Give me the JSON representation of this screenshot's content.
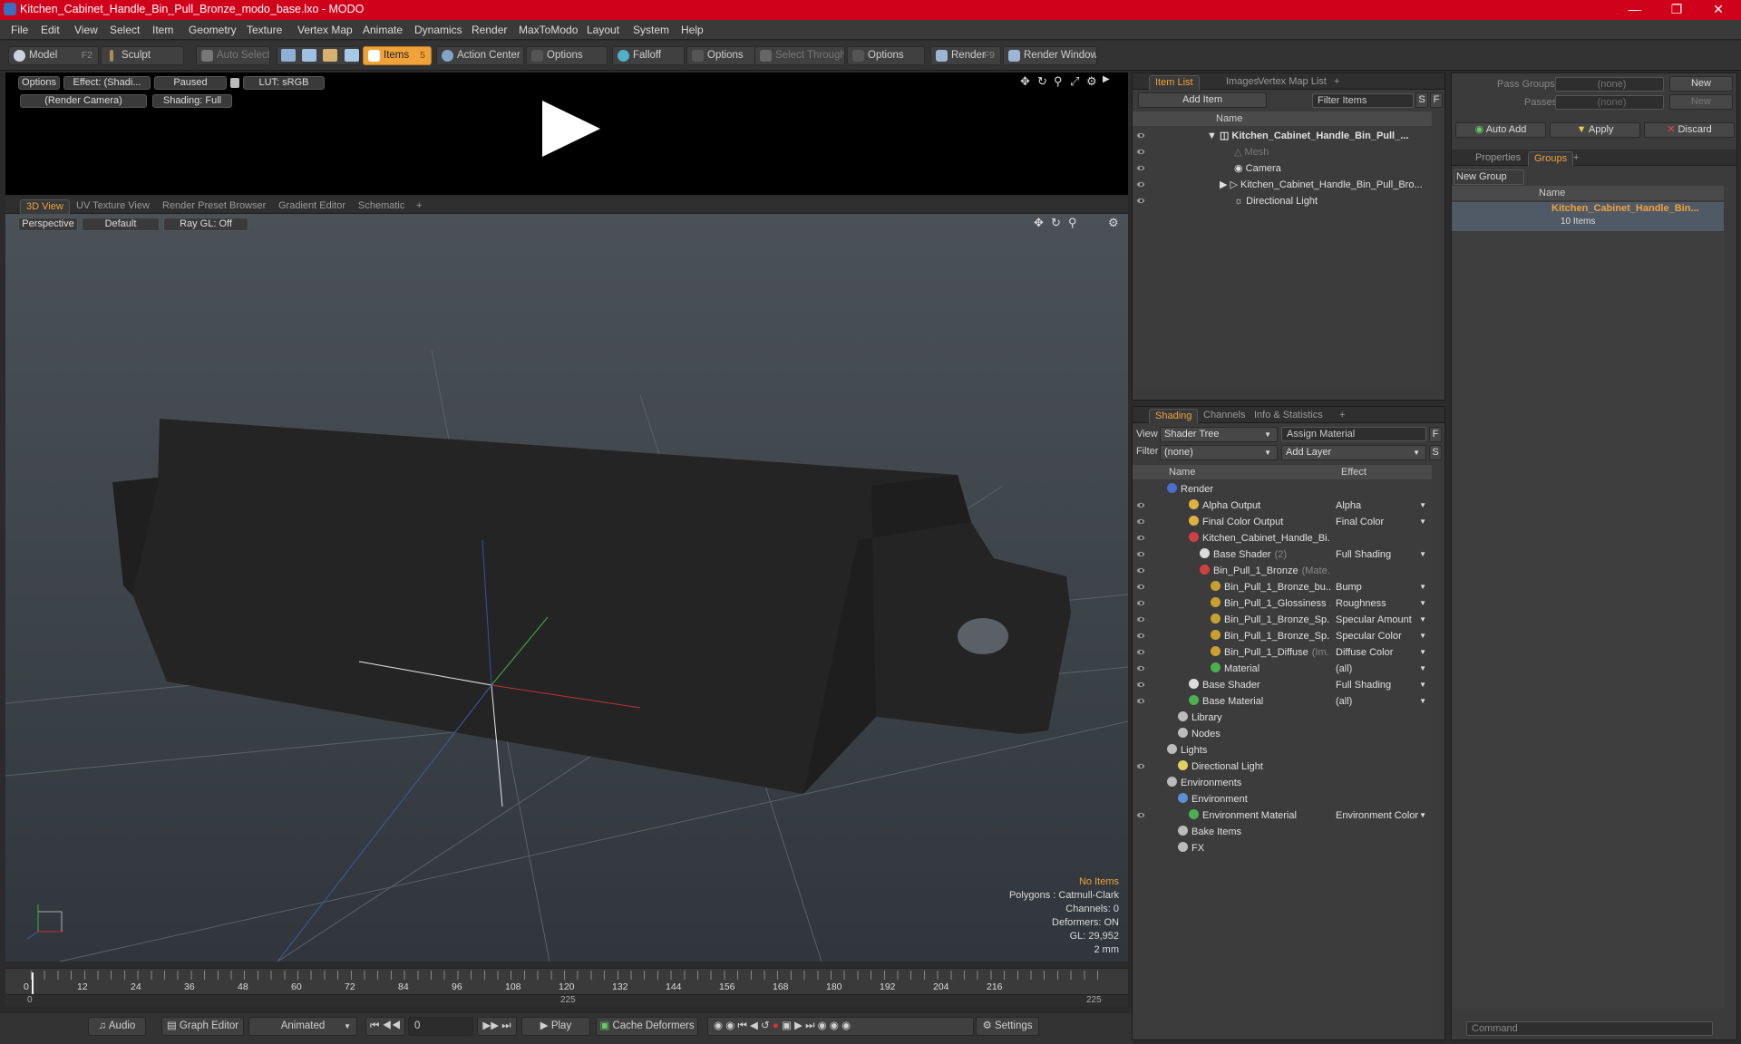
{
  "window": {
    "title": "Kitchen_Cabinet_Handle_Bin_Pull_Bronze_modo_base.lxo - MODO",
    "controls": [
      "minimize",
      "maximize",
      "close"
    ]
  },
  "menu": [
    "File",
    "Edit",
    "View",
    "Select",
    "Item",
    "Geometry",
    "Texture",
    "Vertex Map",
    "Animate",
    "Dynamics",
    "Render",
    "MaxToModo",
    "Layout",
    "System",
    "Help"
  ],
  "toolbar": {
    "model": "Model",
    "model_key": "F2",
    "sculpt": "Sculpt",
    "auto_select": "Auto Select",
    "items": "Items",
    "items_key": "5",
    "action_center": "Action Center",
    "options1": "Options",
    "falloff": "Falloff",
    "options2": "Options",
    "select_through": "Select Through",
    "options3": "Options",
    "render": "Render",
    "render_key": "F9",
    "render_window": "Render Window"
  },
  "preview": {
    "options": "Options",
    "effect": "Effect: (Shadi...",
    "paused": "Paused",
    "lut": "LUT: sRGB",
    "camera": "(Render Camera)",
    "shading": "Shading: Full"
  },
  "view_tabs": [
    "3D View",
    "UV Texture View",
    "Render Preset Browser",
    "Gradient Editor",
    "Schematic",
    "+"
  ],
  "viewport": {
    "projection": "Perspective",
    "style": "Default",
    "raygl": "Ray GL: Off",
    "info": [
      "No Items",
      "Polygons : Catmull-Clark",
      "Channels: 0",
      "Deformers: ON",
      "GL: 29,952",
      "2 mm"
    ]
  },
  "timeline": {
    "ticks": [
      "0",
      "12",
      "24",
      "36",
      "48",
      "60",
      "72",
      "84",
      "96",
      "108",
      "120",
      "132",
      "144",
      "156",
      "168",
      "180",
      "192",
      "204",
      "216"
    ],
    "start": "0",
    "mid": "225",
    "end": "225"
  },
  "bottom": {
    "audio": "Audio",
    "graph_editor": "Graph Editor",
    "animated": "Animated",
    "frame": "0",
    "play": "Play",
    "cache": "Cache Deformers",
    "settings": "Settings"
  },
  "item_panel": {
    "tabs": [
      "Item List",
      "Images",
      "Vertex Map List",
      "+"
    ],
    "add_item": "Add Item",
    "filter": "Filter Items",
    "s": "S",
    "f": "F",
    "col_name": "Name",
    "items": [
      "Kitchen_Cabinet_Handle_Bin_Pull_...",
      "Mesh",
      "Camera",
      "Kitchen_Cabinet_Handle_Bin_Pull_Bro...",
      "Directional Light"
    ]
  },
  "shading_panel": {
    "tabs": [
      "Shading",
      "Channels",
      "Info & Statistics",
      "+"
    ],
    "view_label": "View",
    "view_value": "Shader Tree",
    "assign": "Assign Material",
    "filter_label": "Filter",
    "filter_value": "(none)",
    "add_layer": "Add Layer",
    "col_name": "Name",
    "col_effect": "Effect",
    "rows": [
      {
        "name": "Render",
        "effect": ""
      },
      {
        "name": "Alpha Output",
        "effect": "Alpha"
      },
      {
        "name": "Final Color Output",
        "effect": "Final Color"
      },
      {
        "name": "Kitchen_Cabinet_Handle_Bi...",
        "effect": ""
      },
      {
        "name": "Base Shader",
        "suffix": "(2)",
        "effect": "Full Shading"
      },
      {
        "name": "Bin_Pull_1_Bronze",
        "suffix": "(Mate...",
        "effect": ""
      },
      {
        "name": "Bin_Pull_1_Bronze_bu...",
        "effect": "Bump"
      },
      {
        "name": "Bin_Pull_1_Glossiness ...",
        "effect": "Roughness"
      },
      {
        "name": "Bin_Pull_1_Bronze_Sp...",
        "effect": "Specular Amount"
      },
      {
        "name": "Bin_Pull_1_Bronze_Sp...",
        "effect": "Specular Color"
      },
      {
        "name": "Bin_Pull_1_Diffuse",
        "suffix": "(Im...",
        "effect": "Diffuse Color"
      },
      {
        "name": "Material",
        "effect": "(all)"
      },
      {
        "name": "Base Shader",
        "effect": "Full Shading"
      },
      {
        "name": "Base Material",
        "effect": "(all)"
      },
      {
        "name": "Library",
        "effect": ""
      },
      {
        "name": "Nodes",
        "effect": ""
      },
      {
        "name": "Lights",
        "effect": ""
      },
      {
        "name": "Directional Light",
        "effect": ""
      },
      {
        "name": "Environments",
        "effect": ""
      },
      {
        "name": "Environment",
        "effect": ""
      },
      {
        "name": "Environment Material",
        "effect": "Environment Color"
      },
      {
        "name": "Bake Items",
        "effect": ""
      },
      {
        "name": "FX",
        "effect": ""
      }
    ]
  },
  "right_panel": {
    "pass_groups": "Pass Groups",
    "passes": "Passes",
    "none": "(none)",
    "new": "New",
    "auto_add": "Auto Add",
    "apply": "Apply",
    "discard": "Discard",
    "tabs": [
      "Properties",
      "Groups",
      "+"
    ],
    "new_group": "New Group",
    "col_name": "Name",
    "group_name": "Kitchen_Cabinet_Handle_Bin...",
    "group_count": "10 Items",
    "command": "Command"
  },
  "colors": {
    "accent": "#f0a23a",
    "title": "#d0021b"
  }
}
